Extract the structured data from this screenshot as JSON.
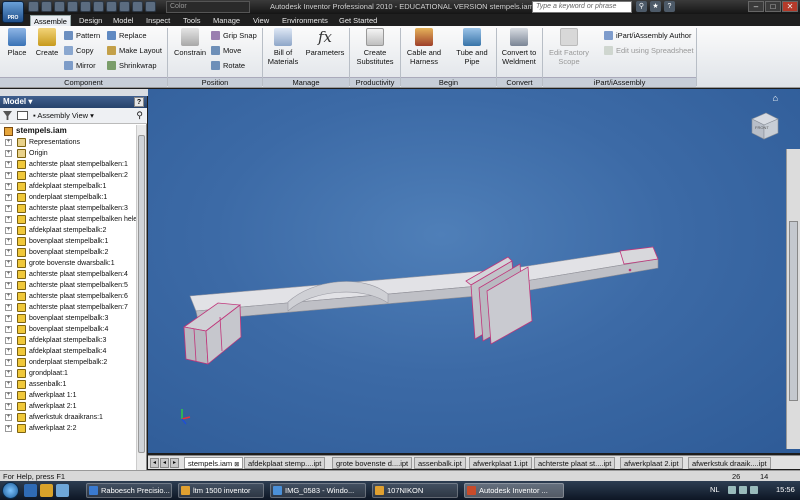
{
  "titlebar": {
    "logo_text": "PRO",
    "color_combo": "Color",
    "window_title": "Autodesk Inventor Professional 2010 - EDUCATIONAL VERSION    stempels.iam",
    "search_placeholder": "Type a keyword or phrase",
    "help_q": "?",
    "minimize": "–",
    "maximize": "□",
    "close": "✕"
  },
  "ribbon_tabs": [
    "Assemble",
    "Design",
    "Model",
    "Inspect",
    "Tools",
    "Manage",
    "View",
    "Environments",
    "Get Started"
  ],
  "ribbon": {
    "component": {
      "label": "Component",
      "place": "Place",
      "create": "Create",
      "pattern": "Pattern",
      "copy": "Copy",
      "mirror": "Mirror",
      "replace": "Replace",
      "make_layout": "Make Layout",
      "shrinkwrap": "Shrinkwrap"
    },
    "position": {
      "label": "Position",
      "constrain": "Constrain",
      "grip_snap": "Grip Snap",
      "move": "Move",
      "rotate": "Rotate"
    },
    "manage": {
      "label": "Manage",
      "bom_line1": "Bill of",
      "bom_line2": "Materials",
      "parameters": "Parameters"
    },
    "productivity": {
      "label": "Productivity",
      "line1": "Create",
      "line2": "Substitutes"
    },
    "begin": {
      "label": "Begin",
      "cable_line1": "Cable and",
      "cable_line2": "Harness",
      "tube_line1": "Tube and",
      "tube_line2": "Pipe"
    },
    "convert": {
      "label": "Convert",
      "line1": "Convert to",
      "line2": "Weldment"
    },
    "ipart": {
      "label": "iPart/iAssembly",
      "factory_line1": "Edit Factory",
      "factory_line2": "Scope",
      "author": "iPart/iAssembly Author",
      "spreadsheet": "Edit using Spreadsheet"
    }
  },
  "browser": {
    "header": "Model",
    "help": "?",
    "view_label": "Assembly View",
    "root": "stempels.iam",
    "items": [
      "Representations",
      "Origin",
      "achterste plaat stempelbalken:1",
      "achterste plaat stempelbalken:2",
      "afdekplaat stempelbalk:1",
      "onderplaat stempelbalk:1",
      "achterste plaat stempelbalken:3",
      "achterste plaat stempelbalken hele",
      "afdekplaat stempelbalk:2",
      "bovenplaat stempelbalk:1",
      "bovenplaat stempelbalk:2",
      "grote bovenste dwarsbalk:1",
      "achterste plaat stempelbalken:4",
      "achterste plaat stempelbalken:5",
      "achterste plaat stempelbalken:6",
      "achterste plaat stempelbalken:7",
      "bovenplaat stempelbalk:3",
      "bovenplaat stempelbalk:4",
      "afdekplaat stempelbalk:3",
      "afdekplaat stempelbalk:4",
      "onderplaat stempelbalk:2",
      "grondplaat:1",
      "assenbalk:1",
      "afwerkplaat 1:1",
      "afwerkplaat 2:1",
      "afwerkstuk draaikrans:1",
      "afwerkplaat 2:2"
    ]
  },
  "viewport": {
    "viewcube_label": "FRONT",
    "home": "⌂"
  },
  "doc_tabs": [
    "stempels.iam",
    "afdekplaat stemp....ipt",
    "grote bovenste d....ipt",
    "assenbalk.ipt",
    "afwerkplaat 1.ipt",
    "achterste plaat st....ipt",
    "afwerkplaat 2.ipt",
    "afwerkstuk draaik....ipt"
  ],
  "status": {
    "text": "For Help, press F1",
    "num1": "26",
    "num2": "14"
  },
  "taskbar": {
    "tasks": [
      "Raboesch Precisio...",
      "ltm 1500 inventor",
      "IMG_0583 - Windo...",
      "107NIKON",
      "Autodesk Inventor ..."
    ],
    "lang": "NL",
    "clock": "15:56"
  },
  "colors": {
    "viewport_bg": "#3c6aa6",
    "model_face": "#d2d2d6",
    "model_edge": "#c0357a"
  }
}
